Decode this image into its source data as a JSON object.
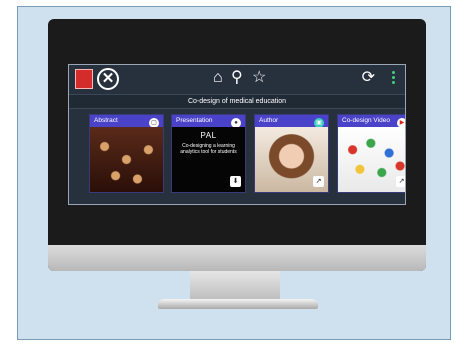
{
  "toolbar": {
    "close_glyph": "✕",
    "home_glyph": "⌂",
    "people_glyph": "⚲",
    "star_glyph": "☆",
    "refresh_glyph": "⟳"
  },
  "subtitle": "Co-design of medical education",
  "cards": [
    {
      "label": "Abstract",
      "badge": "▢",
      "badge_icon": "document-icon"
    },
    {
      "label": "Presentation",
      "badge": "●",
      "badge_icon": "presentation-icon",
      "action": "⬇",
      "slide_title": "PAL",
      "slide_text": "Co-designing a learning analytics tool for students"
    },
    {
      "label": "Author",
      "badge": "▣",
      "badge_icon": "contact-icon",
      "action": "↗"
    },
    {
      "label": "Co-design Video",
      "badge": "▶",
      "badge_icon": "youtube-icon",
      "action": "↗"
    }
  ],
  "colors": {
    "background": "#cfe1ee",
    "card_header": "#4a42c8",
    "app_background": "#27313e",
    "accent_dots": "#3fd07a",
    "brand_square": "#d42b2b"
  }
}
